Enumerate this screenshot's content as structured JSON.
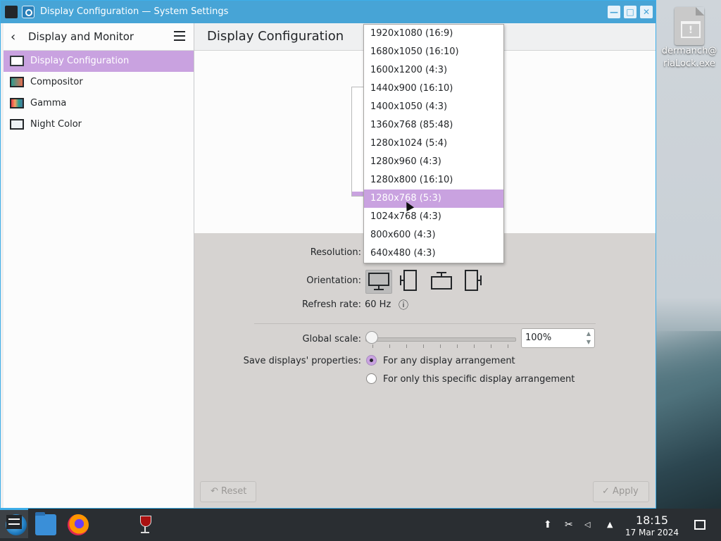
{
  "window": {
    "title": "Display Configuration — System Settings",
    "buttons": {
      "minimize": "—",
      "maximize": "□",
      "close": "✕"
    }
  },
  "sidebar": {
    "title": "Display and Monitor",
    "items": [
      {
        "label": "Display Configuration",
        "icon": "monitor-icon",
        "active": true
      },
      {
        "label": "Compositor",
        "icon": "compositor-icon",
        "active": false
      },
      {
        "label": "Gamma",
        "icon": "gamma-icon",
        "active": false
      },
      {
        "label": "Night Color",
        "icon": "night-color-icon",
        "active": false
      }
    ]
  },
  "main": {
    "title": "Display Configuration",
    "resolution_label": "Resolution:",
    "orientation_label": "Orientation:",
    "refresh_label": "Refresh rate:",
    "refresh_value": "60 Hz",
    "global_scale_label": "Global scale:",
    "global_scale_value": "100%",
    "global_scale_level": 0,
    "save_label": "Save displays' properties:",
    "save_options": [
      {
        "label": "For any display arrangement",
        "checked": true
      },
      {
        "label": "For only this specific display arrangement",
        "checked": false
      }
    ],
    "reset_label": "Reset",
    "apply_label": "Apply"
  },
  "resolution_dropdown": {
    "options": [
      "1920x1080 (16:9)",
      "1680x1050 (16:10)",
      "1600x1200 (4:3)",
      "1440x900 (16:10)",
      "1400x1050 (4:3)",
      "1360x768 (85:48)",
      "1280x1024 (5:4)",
      "1280x960 (4:3)",
      "1280x800 (16:10)",
      "1280x768 (5:3)",
      "1024x768 (4:3)",
      "800x600 (4:3)",
      "640x480 (4:3)"
    ],
    "highlighted": "1280x768 (5:3)"
  },
  "desktop": {
    "icon_label_1": "dermanch@",
    "icon_label_2": "riaLock.exe"
  },
  "taskbar": {
    "time": "18:15",
    "date": "17 Mar 2024"
  },
  "colors": {
    "accent": "#c9a2e0",
    "titlebar": "#47a4d6",
    "taskbar": "#2a2e32"
  }
}
